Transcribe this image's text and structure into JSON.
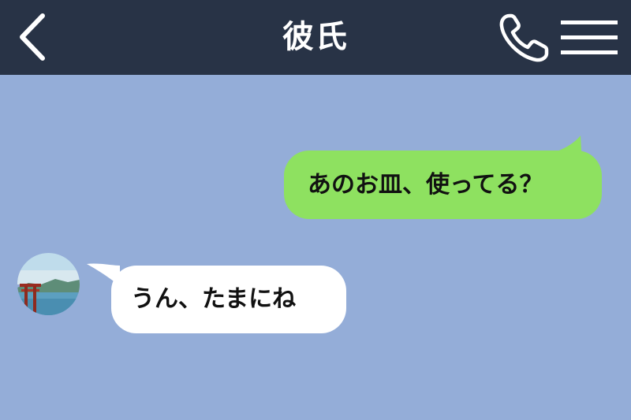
{
  "header": {
    "title": "彼氏",
    "back_icon": "chevron-left-icon",
    "call_icon": "phone-icon",
    "menu_icon": "hamburger-menu-icon"
  },
  "messages": [
    {
      "sender": "me",
      "text": "あのお皿、使ってる？"
    },
    {
      "sender": "partner",
      "text": "うん、たまにね"
    }
  ],
  "colors": {
    "header_bg": "#283346",
    "chat_bg": "#94add8",
    "sent_bubble": "#8ee160",
    "received_bubble": "#ffffff"
  }
}
